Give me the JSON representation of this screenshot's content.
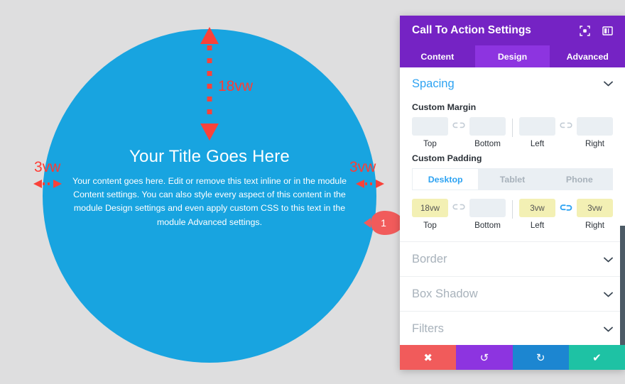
{
  "canvas": {
    "background_color": "#dededf",
    "module": {
      "shape": "circle",
      "background_color": "#18a4e0",
      "title": "Your Title Goes Here",
      "body": "Your content goes here. Edit or remove this text inline or in the module Content settings. You can also style every aspect of this content in the module Design settings and even apply custom CSS to this text in the module Advanced settings."
    },
    "annotations": {
      "color": "#ff3b33",
      "top_padding_label": "18vw",
      "left_padding_label": "3vw",
      "right_padding_label": "3vw",
      "callout_number": "1",
      "callout_color": "#f15b5b"
    }
  },
  "panel": {
    "title": "Call To Action Settings",
    "header_icons": [
      {
        "name": "focus-target-icon"
      },
      {
        "name": "panel-layout-icon"
      }
    ],
    "tabs": [
      {
        "label": "Content",
        "active": false
      },
      {
        "label": "Design",
        "active": true
      },
      {
        "label": "Advanced",
        "active": false
      }
    ],
    "accent_color": "#2ea3f2",
    "header_color": "#7523c4",
    "active_tab_color": "#8d34e0",
    "spacing": {
      "title": "Spacing",
      "expanded": true,
      "custom_margin": {
        "label": "Custom Margin",
        "fields": [
          {
            "caption": "Top",
            "value": "",
            "filled": false
          },
          {
            "caption": "Bottom",
            "value": "",
            "filled": false
          },
          {
            "caption": "Left",
            "value": "",
            "filled": false
          },
          {
            "caption": "Right",
            "value": "",
            "filled": false
          }
        ],
        "link_top_bottom": "unlinked",
        "link_left_right": "unlinked"
      },
      "custom_padding": {
        "label": "Custom Padding",
        "devices": [
          {
            "label": "Desktop",
            "active": true
          },
          {
            "label": "Tablet",
            "active": false
          },
          {
            "label": "Phone",
            "active": false
          }
        ],
        "fields": [
          {
            "caption": "Top",
            "value": "18vw",
            "filled": true
          },
          {
            "caption": "Bottom",
            "value": "",
            "filled": false
          },
          {
            "caption": "Left",
            "value": "3vw",
            "filled": true
          },
          {
            "caption": "Right",
            "value": "3vw",
            "filled": true
          }
        ],
        "link_top_bottom": "unlinked",
        "link_left_right": "linked"
      }
    },
    "accordions": [
      {
        "label": "Border"
      },
      {
        "label": "Box Shadow"
      },
      {
        "label": "Filters"
      }
    ],
    "footer_buttons": [
      {
        "name": "cancel-button",
        "icon": "close-icon",
        "glyph": "✖",
        "color": "#f15b5b"
      },
      {
        "name": "undo-button",
        "icon": "undo-icon",
        "glyph": "↺",
        "color": "#8d34e0"
      },
      {
        "name": "redo-button",
        "icon": "redo-icon",
        "glyph": "↻",
        "color": "#1c86d1"
      },
      {
        "name": "save-button",
        "icon": "check-icon",
        "glyph": "✔",
        "color": "#1ec2a4"
      }
    ]
  }
}
